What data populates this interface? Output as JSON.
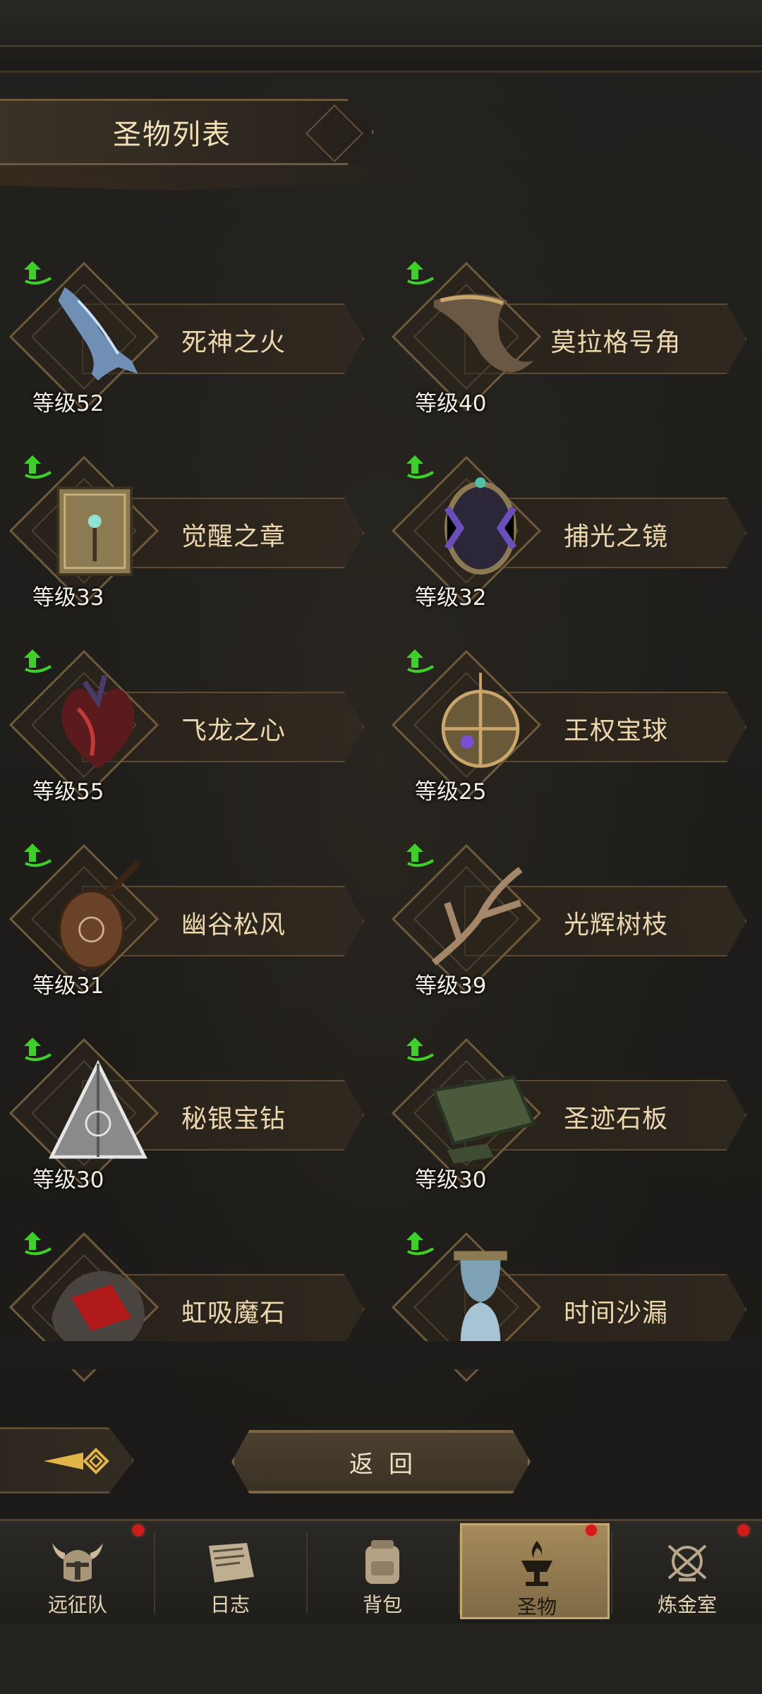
{
  "header": {
    "title": "圣物列表"
  },
  "relics": [
    {
      "name": "死神之火",
      "level": "等级52"
    },
    {
      "name": "莫拉格号角",
      "level": "等级40"
    },
    {
      "name": "觉醒之章",
      "level": "等级33"
    },
    {
      "name": "捕光之镜",
      "level": "等级32"
    },
    {
      "name": "飞龙之心",
      "level": "等级55"
    },
    {
      "name": "王权宝球",
      "level": "等级25"
    },
    {
      "name": "幽谷松风",
      "level": "等级31"
    },
    {
      "name": "光辉树枝",
      "level": "等级39"
    },
    {
      "name": "秘银宝钻",
      "level": "等级30"
    },
    {
      "name": "圣迹石板",
      "level": "等级30"
    },
    {
      "name": "虹吸魔石",
      "level": ""
    },
    {
      "name": "时间沙漏",
      "level": ""
    }
  ],
  "controls": {
    "return_label": "返回"
  },
  "tabs": [
    {
      "label": "远征队",
      "icon": "helmet-icon",
      "badge": true
    },
    {
      "label": "日志",
      "icon": "scroll-icon",
      "badge": false
    },
    {
      "label": "背包",
      "icon": "backpack-icon",
      "badge": false
    },
    {
      "label": "圣物",
      "icon": "brazier-icon",
      "badge": true,
      "active": true
    },
    {
      "label": "炼金室",
      "icon": "alchemy-icon",
      "badge": true
    }
  ],
  "colors": {
    "accent_gold": "#c7a86f",
    "upgrade_green": "#3fcf2a",
    "badge_red": "#d11a1a"
  }
}
